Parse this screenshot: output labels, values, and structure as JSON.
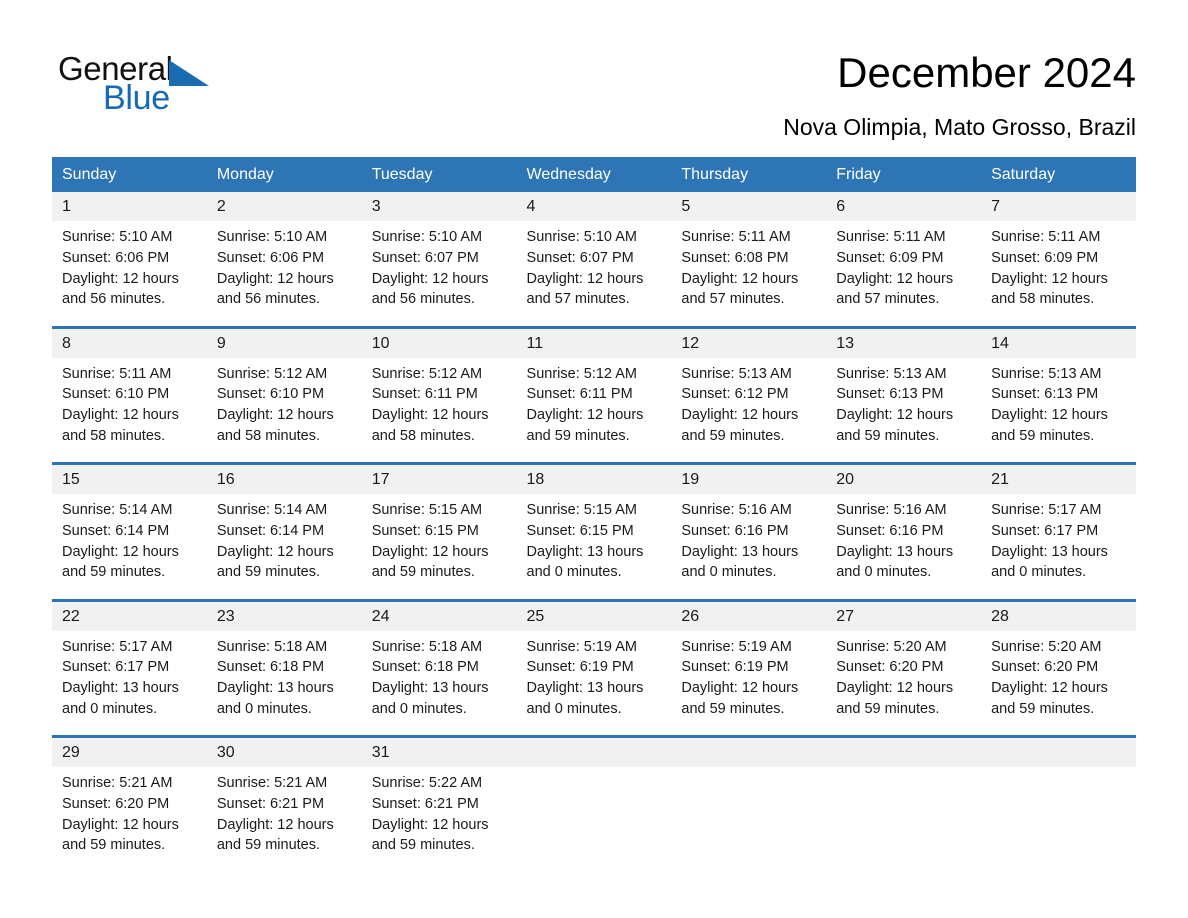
{
  "brand": {
    "name_part1": "General",
    "name_part2": "Blue",
    "accent_color": "#1669b8",
    "logo_icon": "triangle-flag-icon"
  },
  "header": {
    "title": "December 2024",
    "subtitle": "Nova Olimpia, Mato Grosso, Brazil"
  },
  "calendar": {
    "header_bg": "#2e75b6",
    "daynum_bg": "#f1f1f1",
    "weekdays": [
      "Sunday",
      "Monday",
      "Tuesday",
      "Wednesday",
      "Thursday",
      "Friday",
      "Saturday"
    ],
    "weeks": [
      [
        {
          "day": "1",
          "sunrise": "Sunrise: 5:10 AM",
          "sunset": "Sunset: 6:06 PM",
          "daylight": "Daylight: 12 hours and 56 minutes."
        },
        {
          "day": "2",
          "sunrise": "Sunrise: 5:10 AM",
          "sunset": "Sunset: 6:06 PM",
          "daylight": "Daylight: 12 hours and 56 minutes."
        },
        {
          "day": "3",
          "sunrise": "Sunrise: 5:10 AM",
          "sunset": "Sunset: 6:07 PM",
          "daylight": "Daylight: 12 hours and 56 minutes."
        },
        {
          "day": "4",
          "sunrise": "Sunrise: 5:10 AM",
          "sunset": "Sunset: 6:07 PM",
          "daylight": "Daylight: 12 hours and 57 minutes."
        },
        {
          "day": "5",
          "sunrise": "Sunrise: 5:11 AM",
          "sunset": "Sunset: 6:08 PM",
          "daylight": "Daylight: 12 hours and 57 minutes."
        },
        {
          "day": "6",
          "sunrise": "Sunrise: 5:11 AM",
          "sunset": "Sunset: 6:09 PM",
          "daylight": "Daylight: 12 hours and 57 minutes."
        },
        {
          "day": "7",
          "sunrise": "Sunrise: 5:11 AM",
          "sunset": "Sunset: 6:09 PM",
          "daylight": "Daylight: 12 hours and 58 minutes."
        }
      ],
      [
        {
          "day": "8",
          "sunrise": "Sunrise: 5:11 AM",
          "sunset": "Sunset: 6:10 PM",
          "daylight": "Daylight: 12 hours and 58 minutes."
        },
        {
          "day": "9",
          "sunrise": "Sunrise: 5:12 AM",
          "sunset": "Sunset: 6:10 PM",
          "daylight": "Daylight: 12 hours and 58 minutes."
        },
        {
          "day": "10",
          "sunrise": "Sunrise: 5:12 AM",
          "sunset": "Sunset: 6:11 PM",
          "daylight": "Daylight: 12 hours and 58 minutes."
        },
        {
          "day": "11",
          "sunrise": "Sunrise: 5:12 AM",
          "sunset": "Sunset: 6:11 PM",
          "daylight": "Daylight: 12 hours and 59 minutes."
        },
        {
          "day": "12",
          "sunrise": "Sunrise: 5:13 AM",
          "sunset": "Sunset: 6:12 PM",
          "daylight": "Daylight: 12 hours and 59 minutes."
        },
        {
          "day": "13",
          "sunrise": "Sunrise: 5:13 AM",
          "sunset": "Sunset: 6:13 PM",
          "daylight": "Daylight: 12 hours and 59 minutes."
        },
        {
          "day": "14",
          "sunrise": "Sunrise: 5:13 AM",
          "sunset": "Sunset: 6:13 PM",
          "daylight": "Daylight: 12 hours and 59 minutes."
        }
      ],
      [
        {
          "day": "15",
          "sunrise": "Sunrise: 5:14 AM",
          "sunset": "Sunset: 6:14 PM",
          "daylight": "Daylight: 12 hours and 59 minutes."
        },
        {
          "day": "16",
          "sunrise": "Sunrise: 5:14 AM",
          "sunset": "Sunset: 6:14 PM",
          "daylight": "Daylight: 12 hours and 59 minutes."
        },
        {
          "day": "17",
          "sunrise": "Sunrise: 5:15 AM",
          "sunset": "Sunset: 6:15 PM",
          "daylight": "Daylight: 12 hours and 59 minutes."
        },
        {
          "day": "18",
          "sunrise": "Sunrise: 5:15 AM",
          "sunset": "Sunset: 6:15 PM",
          "daylight": "Daylight: 13 hours and 0 minutes."
        },
        {
          "day": "19",
          "sunrise": "Sunrise: 5:16 AM",
          "sunset": "Sunset: 6:16 PM",
          "daylight": "Daylight: 13 hours and 0 minutes."
        },
        {
          "day": "20",
          "sunrise": "Sunrise: 5:16 AM",
          "sunset": "Sunset: 6:16 PM",
          "daylight": "Daylight: 13 hours and 0 minutes."
        },
        {
          "day": "21",
          "sunrise": "Sunrise: 5:17 AM",
          "sunset": "Sunset: 6:17 PM",
          "daylight": "Daylight: 13 hours and 0 minutes."
        }
      ],
      [
        {
          "day": "22",
          "sunrise": "Sunrise: 5:17 AM",
          "sunset": "Sunset: 6:17 PM",
          "daylight": "Daylight: 13 hours and 0 minutes."
        },
        {
          "day": "23",
          "sunrise": "Sunrise: 5:18 AM",
          "sunset": "Sunset: 6:18 PM",
          "daylight": "Daylight: 13 hours and 0 minutes."
        },
        {
          "day": "24",
          "sunrise": "Sunrise: 5:18 AM",
          "sunset": "Sunset: 6:18 PM",
          "daylight": "Daylight: 13 hours and 0 minutes."
        },
        {
          "day": "25",
          "sunrise": "Sunrise: 5:19 AM",
          "sunset": "Sunset: 6:19 PM",
          "daylight": "Daylight: 13 hours and 0 minutes."
        },
        {
          "day": "26",
          "sunrise": "Sunrise: 5:19 AM",
          "sunset": "Sunset: 6:19 PM",
          "daylight": "Daylight: 12 hours and 59 minutes."
        },
        {
          "day": "27",
          "sunrise": "Sunrise: 5:20 AM",
          "sunset": "Sunset: 6:20 PM",
          "daylight": "Daylight: 12 hours and 59 minutes."
        },
        {
          "day": "28",
          "sunrise": "Sunrise: 5:20 AM",
          "sunset": "Sunset: 6:20 PM",
          "daylight": "Daylight: 12 hours and 59 minutes."
        }
      ],
      [
        {
          "day": "29",
          "sunrise": "Sunrise: 5:21 AM",
          "sunset": "Sunset: 6:20 PM",
          "daylight": "Daylight: 12 hours and 59 minutes."
        },
        {
          "day": "30",
          "sunrise": "Sunrise: 5:21 AM",
          "sunset": "Sunset: 6:21 PM",
          "daylight": "Daylight: 12 hours and 59 minutes."
        },
        {
          "day": "31",
          "sunrise": "Sunrise: 5:22 AM",
          "sunset": "Sunset: 6:21 PM",
          "daylight": "Daylight: 12 hours and 59 minutes."
        },
        {
          "day": "",
          "sunrise": "",
          "sunset": "",
          "daylight": ""
        },
        {
          "day": "",
          "sunrise": "",
          "sunset": "",
          "daylight": ""
        },
        {
          "day": "",
          "sunrise": "",
          "sunset": "",
          "daylight": ""
        },
        {
          "day": "",
          "sunrise": "",
          "sunset": "",
          "daylight": ""
        }
      ]
    ]
  }
}
